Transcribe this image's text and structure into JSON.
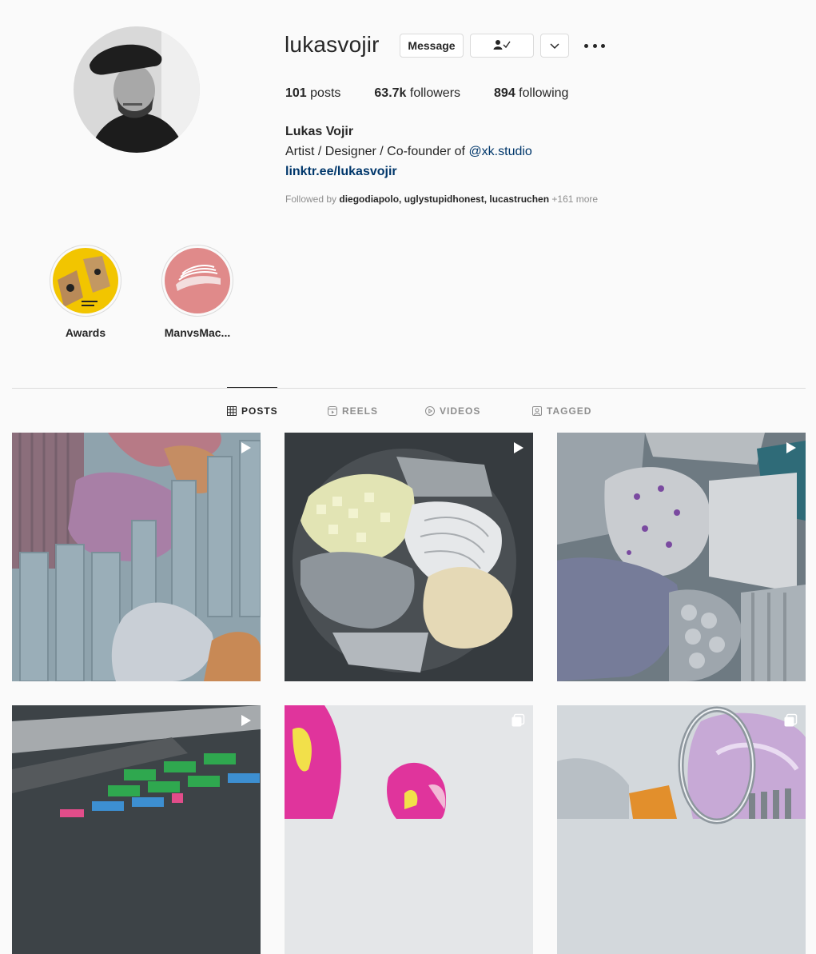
{
  "profile": {
    "username": "lukasvojir",
    "full_name": "Lukas Vojir",
    "bio_text": "Artist / Designer / Co-founder of ",
    "bio_mention": "@xk.studio",
    "link": "linktr.ee/lukasvojir",
    "followed_prefix": "Followed by ",
    "followed_names": "diegodiapolo, uglystupidhonest, lucastruchen",
    "followed_more": " +161 more"
  },
  "actions": {
    "message_label": "Message",
    "follow_icon": "person-check-icon",
    "dropdown_icon": "chevron-down-icon",
    "more_icon": "more-dots-icon"
  },
  "stats": [
    {
      "value": "101",
      "label": " posts"
    },
    {
      "value": "63.7k",
      "label": " followers"
    },
    {
      "value": "894",
      "label": " following"
    }
  ],
  "highlights": [
    {
      "label": "Awards"
    },
    {
      "label": "ManvsMac..."
    }
  ],
  "tabs": [
    {
      "label": "POSTS",
      "icon": "grid-icon",
      "active": true
    },
    {
      "label": "REELS",
      "icon": "reels-icon",
      "active": false
    },
    {
      "label": "VIDEOS",
      "icon": "play-circle-icon",
      "active": false
    },
    {
      "label": "TAGGED",
      "icon": "tag-user-icon",
      "active": false
    }
  ],
  "posts": [
    {
      "badge": "reel"
    },
    {
      "badge": "reel"
    },
    {
      "badge": "reel"
    },
    {
      "badge": "reel"
    },
    {
      "badge": "carousel"
    },
    {
      "badge": "carousel"
    }
  ]
}
